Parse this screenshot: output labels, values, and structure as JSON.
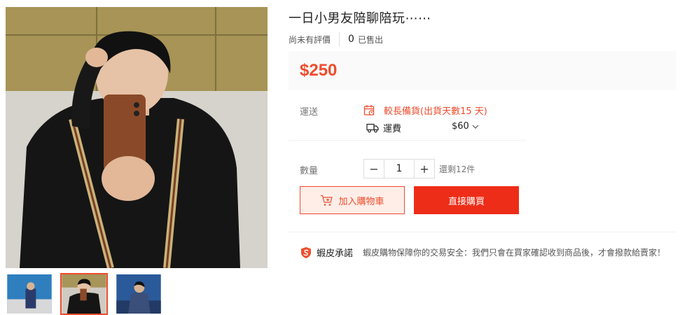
{
  "product": {
    "title": "一日小男友陪聊陪玩⋯⋯",
    "rating_text": "尚未有評價",
    "sold_count": "0",
    "sold_label": "已售出",
    "price": "$250"
  },
  "shipping": {
    "label": "運送",
    "warning": "較長備貨(出貨天數15 天)",
    "fee_label": "運費",
    "fee_value": "$60"
  },
  "quantity": {
    "label": "數量",
    "value": "1",
    "minus": "−",
    "plus": "+",
    "stock": "還剩12件"
  },
  "actions": {
    "add_to_cart": "加入購物車",
    "buy_now": "直接購買"
  },
  "guarantee": {
    "title": "蝦皮承諾",
    "text": "蝦皮購物保障你的交易安全：我們只會在買家確認收到商品後，才會撥款給賣家！"
  },
  "gallery": {
    "thumbnail_count": 3,
    "active_index": 1
  },
  "colors": {
    "accent": "#ee4d2d",
    "buy_button": "#ee2d18",
    "price_bg": "#fafafa"
  },
  "icons": {
    "calendar": "calendar-warning-icon",
    "truck": "truck-icon",
    "chevron": "chevron-down-icon",
    "cart": "cart-plus-icon",
    "shield": "shopee-shield-icon"
  }
}
